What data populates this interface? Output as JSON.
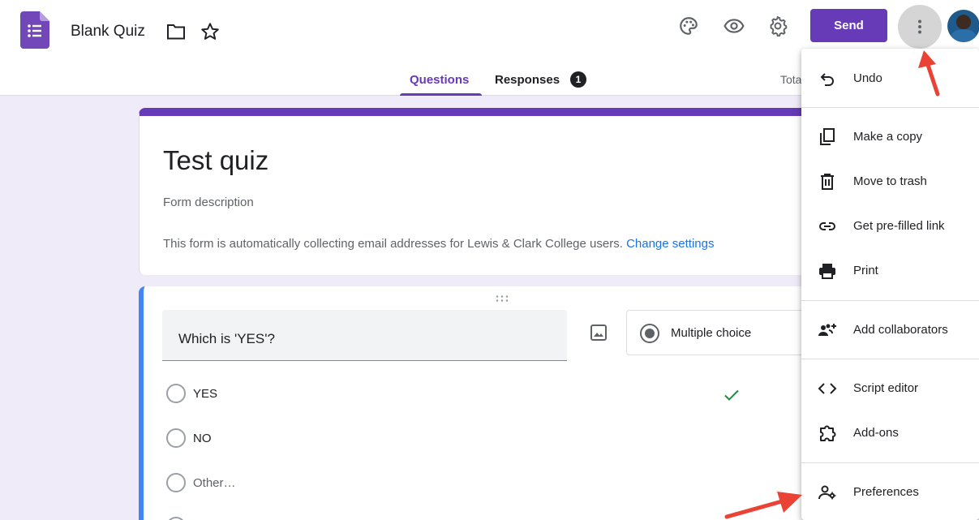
{
  "header": {
    "app_icon": "google-forms-icon",
    "doc_title": "Blank Quiz",
    "send_label": "Send",
    "icons": [
      "folder-icon",
      "star-icon",
      "palette-icon",
      "eye-icon",
      "gear-icon",
      "more-vert-icon",
      "avatar"
    ]
  },
  "tabs": {
    "questions": "Questions",
    "responses": "Responses",
    "responses_count": "1",
    "total_points": "Tota"
  },
  "form": {
    "title": "Test quiz",
    "description": "Form description",
    "email_notice": "This form is automatically collecting email addresses for Lewis & Clark College users.",
    "change_settings": "Change settings"
  },
  "question": {
    "title": "Which is 'YES'?",
    "type": "Multiple choice",
    "options": [
      {
        "label": "YES",
        "correct": true
      },
      {
        "label": "NO"
      },
      {
        "label": "Other…"
      }
    ]
  },
  "menu": {
    "items": [
      {
        "label": "Undo",
        "icon": "undo-icon"
      },
      {
        "label": "Make a copy",
        "icon": "copy-icon"
      },
      {
        "label": "Move to trash",
        "icon": "trash-icon"
      },
      {
        "label": "Get pre-filled link",
        "icon": "link-icon"
      },
      {
        "label": "Print",
        "icon": "print-icon"
      },
      {
        "label": "Add collaborators",
        "icon": "add-collaborators-icon"
      },
      {
        "label": "Script editor",
        "icon": "code-icon"
      },
      {
        "label": "Add-ons",
        "icon": "puzzle-icon"
      },
      {
        "label": "Preferences",
        "icon": "preferences-icon"
      }
    ]
  },
  "colors": {
    "brand": "#673ab7",
    "background": "#f0ebf8",
    "link": "#1a73e8",
    "question_accent": "#4285f4",
    "annotation_arrow": "#ea4335"
  }
}
